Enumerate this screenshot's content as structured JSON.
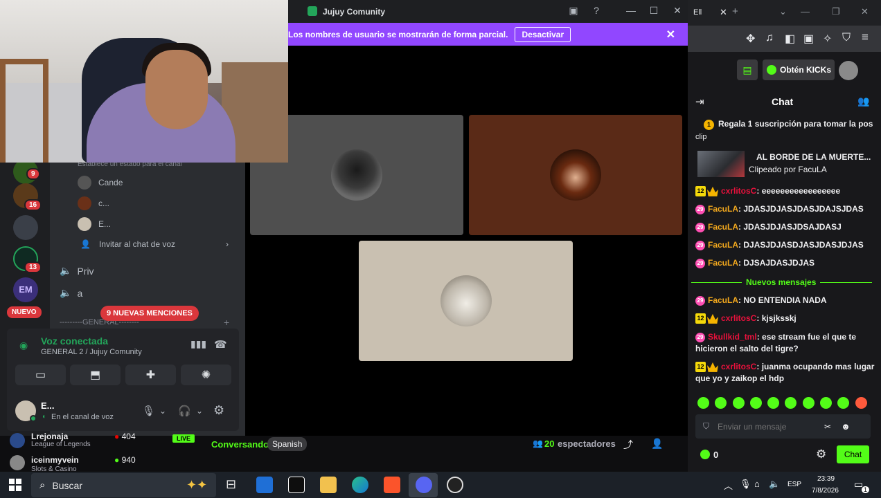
{
  "discord": {
    "window_title": "Jujuy Comunity",
    "banner_text": "Los nombres de usuario se mostrarán de forma parcial.",
    "banner_button": "Desactivar",
    "channel_header_partial": "Establece un estado para el canal",
    "voice_members": [
      "Cande",
      "c...",
      "E..."
    ],
    "invite_label": "Invitar al chat de voz",
    "channels": [
      "Priv",
      "a"
    ],
    "category_partial": "---------GENERAL--------",
    "new_label": "NUEVO",
    "mentions_pill": "9 NUEVAS MENCIONES",
    "server_badges": [
      "9",
      "16",
      "13"
    ],
    "voice_status": "Voz conectada",
    "voice_channel": "GENERAL 2 / Jujuy Comunity",
    "user_name": "E...",
    "user_status": "En el canal de voz"
  },
  "stream_strip": {
    "row1_name": "Lrejonaja",
    "row1_game": "League of Legends",
    "row1_viewers": "404",
    "row2_name": "iceinmyvein",
    "row2_game": "Slots & Casino",
    "row2_viewers": "940",
    "live_label": "LIVE",
    "status": "Conversando",
    "language": "Spanish",
    "viewers_count": "20",
    "viewers_label": "espectadores"
  },
  "kick": {
    "tab_partial": "Ell",
    "get_kicks": "Obtén KICKs",
    "chat_title": "Chat",
    "pinned": "Regala 1 suscripción para tomar la pos",
    "pinned_rank": "1",
    "clip_label": "clip",
    "clip_title": "AL BORDE DE LA MUERTE...",
    "clip_by": "Clipeado por FacuLA",
    "divider": "Nuevos mensajes",
    "messages": [
      {
        "user": "cxrlitosC",
        "text": "eeeeeeeeeeeeeeeee",
        "color": "#e9113c",
        "badge": "12"
      },
      {
        "user": "FacuLA",
        "text": "JDASJDJASJDASJDAJSJDAS",
        "color": "#f2a81d",
        "badge": "29"
      },
      {
        "user": "FacuLA",
        "text": "JDASJDJASJDSAJDASJ",
        "color": "#f2a81d",
        "badge": "29"
      },
      {
        "user": "FacuLA",
        "text": "DJASJDJASDJASJDASJDJAS",
        "color": "#f2a81d",
        "badge": "29"
      },
      {
        "user": "FacuLA",
        "text": "DJSAJDASJDJAS",
        "color": "#f2a81d",
        "badge": "29"
      },
      {
        "user": "FacuLA",
        "text": "NO ENTENDIA NADA",
        "color": "#f2a81d",
        "badge": "29"
      },
      {
        "user": "cxrlitosC",
        "text": "kjsjksskj",
        "color": "#e9113c",
        "badge": "12"
      },
      {
        "user": "Skullkid_tml",
        "text": "ese stream fue el que te hicieron el salto del tigre?",
        "color": "#e9113c",
        "badge": "29"
      },
      {
        "user": "cxrlitosC",
        "text": "juanma ocupando mas lugar que yo y zaikop el hdp",
        "color": "#e9113c",
        "badge": "12"
      }
    ],
    "input_placeholder": "Enviar un mensaje",
    "kicks_balance": "0",
    "chat_button": "Chat"
  },
  "taskbar": {
    "search_placeholder": "Buscar",
    "language": "ESP",
    "time": "23:39",
    "date": "7/8/2026",
    "notif_count": "1"
  },
  "colors": {
    "kick_green": "#53fc18",
    "discord_purple": "#9147ff",
    "mention_red": "#da373c"
  }
}
